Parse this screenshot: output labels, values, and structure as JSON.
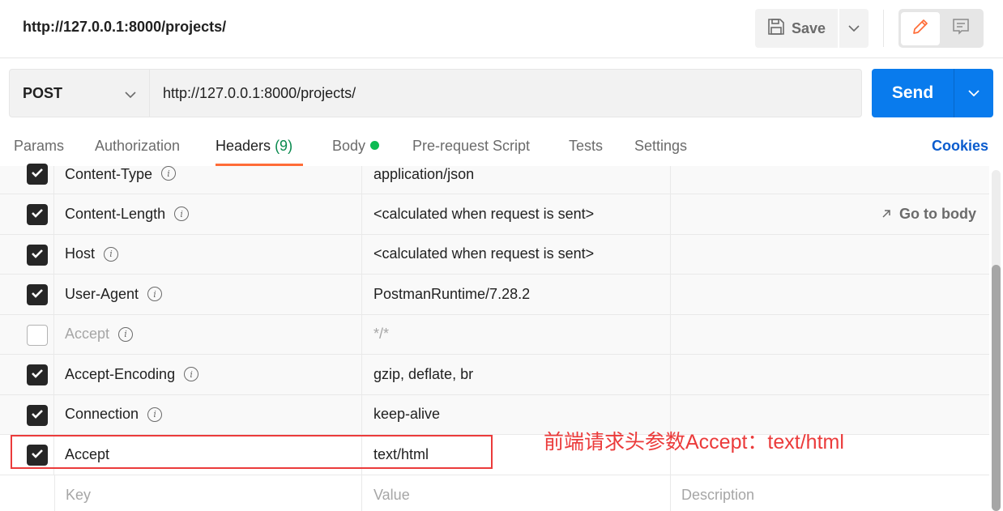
{
  "header": {
    "request_title": "http://127.0.0.1:8000/projects/",
    "save_label": "Save",
    "icons": {
      "save": "floppy-disk-icon",
      "save_dropdown": "chevron-down-icon",
      "edit": "pencil-icon",
      "comments": "comment-icon"
    },
    "accent_color": "#ff6c37"
  },
  "request": {
    "method": "POST",
    "url": "http://127.0.0.1:8000/projects/",
    "send_label": "Send",
    "send_color": "#097bed"
  },
  "tabs": [
    {
      "label": "Params",
      "active": false
    },
    {
      "label": "Authorization",
      "active": false
    },
    {
      "label": "Headers",
      "count": "(9)",
      "active": true
    },
    {
      "label": "Body",
      "has_indicator": true,
      "active": false
    },
    {
      "label": "Pre-request Script",
      "active": false
    },
    {
      "label": "Tests",
      "active": false
    },
    {
      "label": "Settings",
      "active": false
    }
  ],
  "cookies_label": "Cookies",
  "headers_table": {
    "rows": [
      {
        "enabled": true,
        "key": "Content-Type",
        "value": "application/json",
        "description": "",
        "info": true
      },
      {
        "enabled": true,
        "key": "Content-Length",
        "value": "<calculated when request is sent>",
        "description": "",
        "info": true,
        "action": "Go to body"
      },
      {
        "enabled": true,
        "key": "Host",
        "value": "<calculated when request is sent>",
        "description": "",
        "info": true
      },
      {
        "enabled": true,
        "key": "User-Agent",
        "value": "PostmanRuntime/7.28.2",
        "description": "",
        "info": true
      },
      {
        "enabled": false,
        "key": "Accept",
        "value": "*/*",
        "description": "",
        "info": true
      },
      {
        "enabled": true,
        "key": "Accept-Encoding",
        "value": "gzip, deflate, br",
        "description": "",
        "info": true
      },
      {
        "enabled": true,
        "key": "Connection",
        "value": "keep-alive",
        "description": "",
        "info": true
      },
      {
        "enabled": true,
        "key": "Accept",
        "value": "text/html",
        "description": "",
        "info": false
      }
    ],
    "new_row": {
      "key_placeholder": "Key",
      "value_placeholder": "Value",
      "description_placeholder": "Description"
    }
  },
  "annotation": {
    "text": "前端请求头参数Accept：text/html",
    "color": "#eb3b3b"
  }
}
